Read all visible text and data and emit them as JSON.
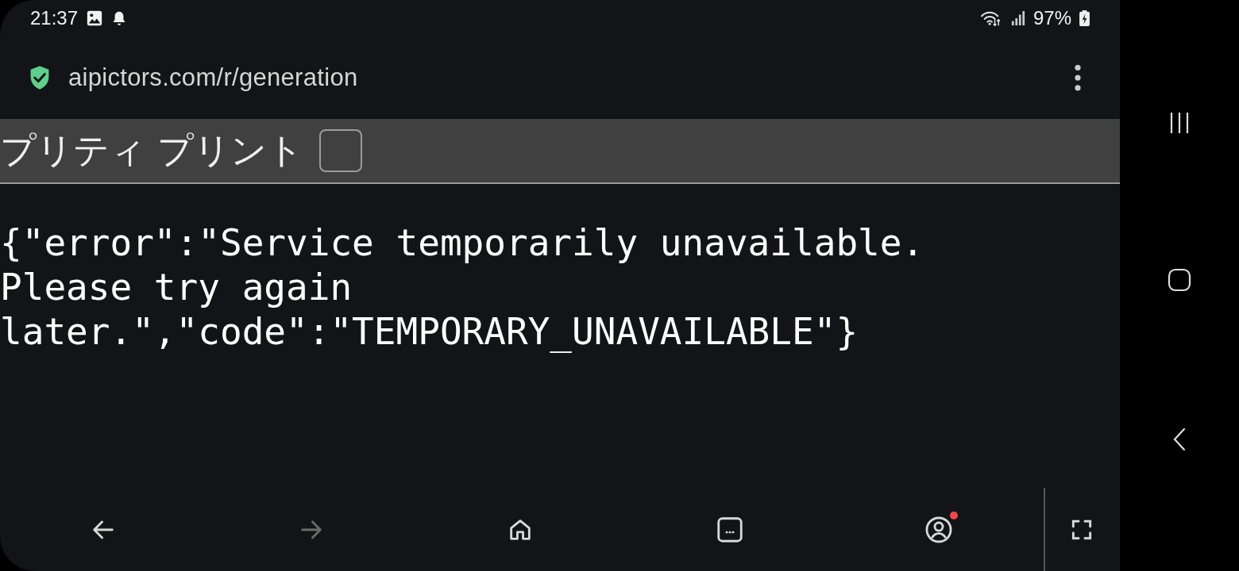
{
  "status_bar": {
    "time": "21:37",
    "battery": "97%"
  },
  "address_bar": {
    "url": "aipictors.com/r/generation"
  },
  "pretty_print": {
    "label": "プリティ プリント",
    "checked": false
  },
  "body": {
    "lines": [
      "{\"error\":\"Service temporarily unavailable.",
      "Please try again",
      "later.\",\"code\":\"TEMPORARY_UNAVAILABLE\"}"
    ]
  },
  "toolbar": [
    {
      "kind": "back",
      "disabled": false
    },
    {
      "kind": "forward",
      "disabled": true
    },
    {
      "kind": "home",
      "disabled": false
    },
    {
      "kind": "tabs",
      "disabled": false
    },
    {
      "kind": "profile",
      "disabled": false,
      "notification_dot": true
    },
    {
      "kind": "fullscreen",
      "disabled": false
    }
  ],
  "nav_bar": [
    {
      "kind": "recents"
    },
    {
      "kind": "home"
    },
    {
      "kind": "back"
    }
  ]
}
